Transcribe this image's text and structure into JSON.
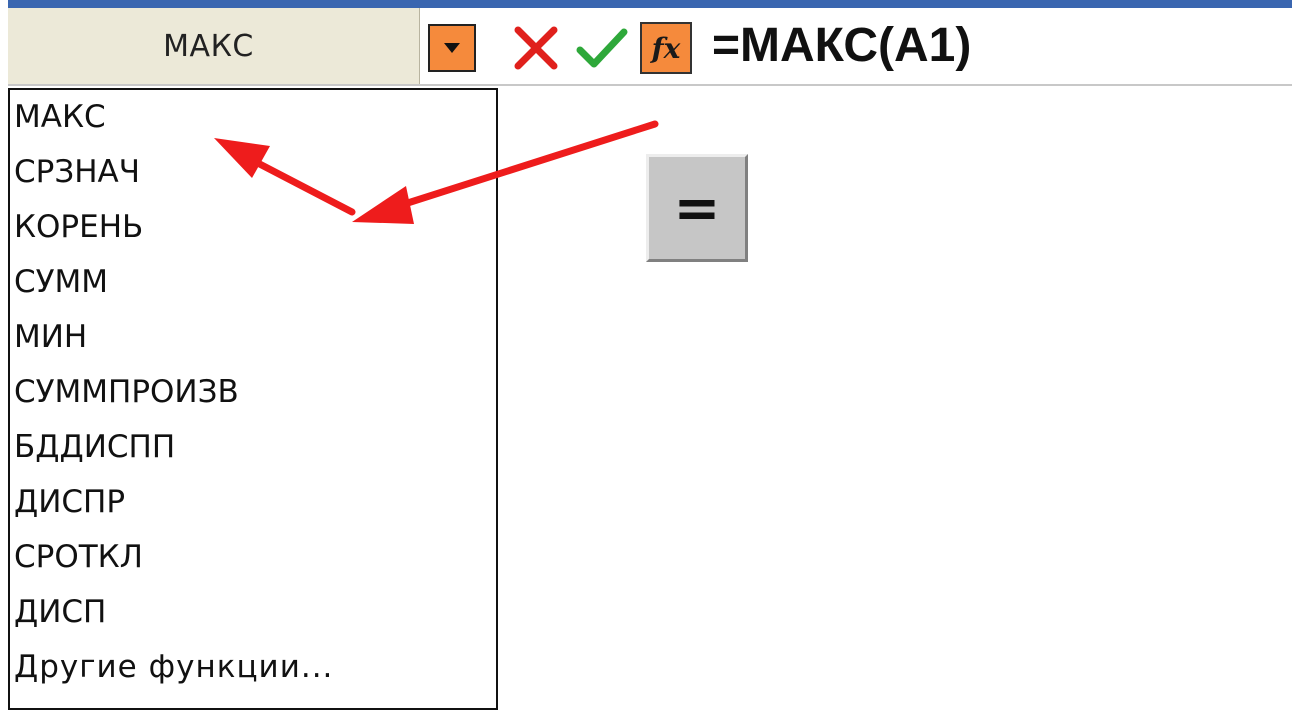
{
  "formula_bar": {
    "name_box": "МАКС",
    "formula": "=МАКС(А1)",
    "fx_label": "fx"
  },
  "dropdown": {
    "items": [
      "МАКС",
      "СРЗНАЧ",
      "КОРЕНЬ",
      "СУММ",
      "МИН",
      "СУММПРОИЗВ",
      "БДДИСПП",
      "ДИСПР",
      "СРОТКЛ",
      "ДИСП",
      "Другие функции..."
    ]
  },
  "equals_button": {
    "label": "="
  },
  "colors": {
    "accent_orange": "#f58a3c",
    "cancel_red": "#e0201c",
    "enter_green": "#2ea83a",
    "arrow_red": "#ee1c1c",
    "title_blue": "#3a66b0"
  },
  "icons": {
    "dropdown": "chevron-down-icon",
    "cancel": "cancel-x-icon",
    "enter": "checkmark-icon",
    "function": "fx-icon"
  }
}
